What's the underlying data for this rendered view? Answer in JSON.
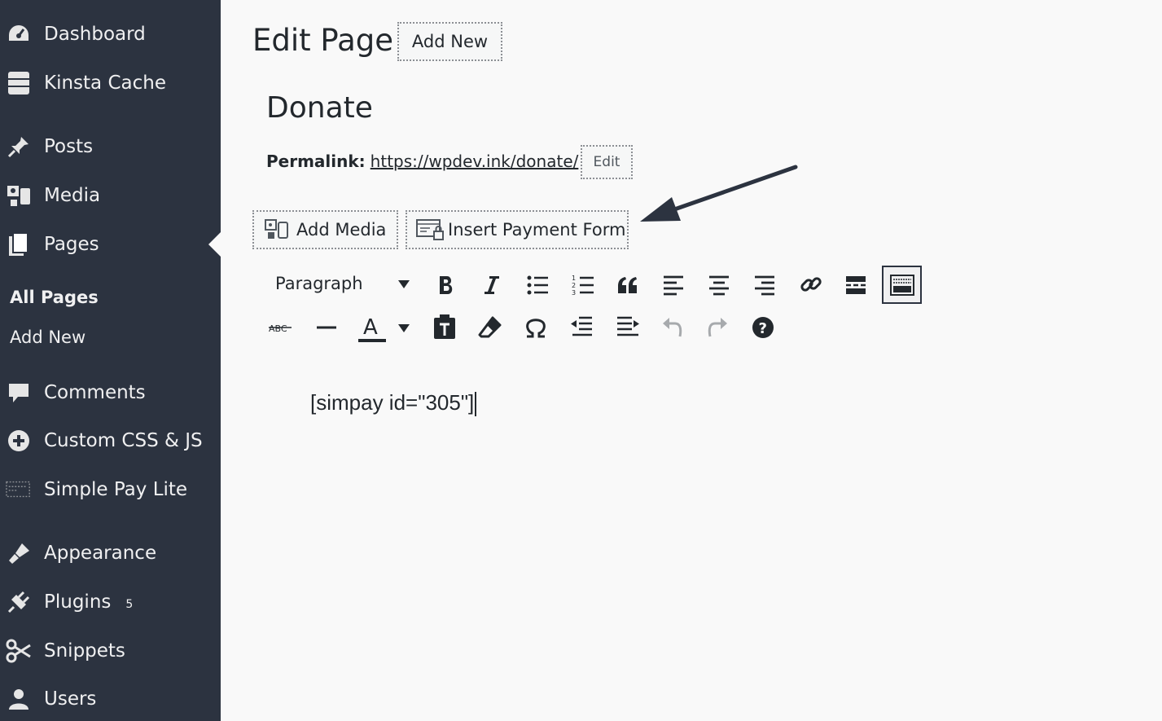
{
  "sidebar": {
    "items": [
      {
        "label": "Dashboard",
        "icon": "dashboard-icon"
      },
      {
        "label": "Kinsta Cache",
        "icon": "database-icon"
      },
      {
        "label": "Posts",
        "icon": "pin-icon"
      },
      {
        "label": "Media",
        "icon": "media-icon"
      },
      {
        "label": "Pages",
        "icon": "pages-icon"
      },
      {
        "label": "Comments",
        "icon": "comment-icon"
      },
      {
        "label": "Custom CSS & JS",
        "icon": "plus-circle-icon"
      },
      {
        "label": "Simple Pay Lite",
        "icon": "payment-icon"
      },
      {
        "label": "Appearance",
        "icon": "brush-icon"
      },
      {
        "label": "Plugins",
        "icon": "plug-icon",
        "count": "5"
      },
      {
        "label": "Snippets",
        "icon": "scissors-icon"
      },
      {
        "label": "Users",
        "icon": "user-icon"
      }
    ],
    "submenu": [
      "All Pages",
      "Add New"
    ]
  },
  "header": {
    "title": "Edit Page",
    "add_new_label": "Add New"
  },
  "post": {
    "title": "Donate",
    "permalink_label": "Permalink:",
    "permalink_url": "https://wpdev.ink/donate/",
    "edit_label": "Edit"
  },
  "media_buttons": {
    "add_media": "Add Media",
    "insert_payment_form": "Insert Payment Form"
  },
  "toolbar": {
    "format_value": "Paragraph"
  },
  "editor": {
    "content": "[simpay id=\"305\"]"
  },
  "colors": {
    "sidebar_bg": "#2c3340",
    "page_bg": "#f9f9f9",
    "text": "#23282d"
  }
}
